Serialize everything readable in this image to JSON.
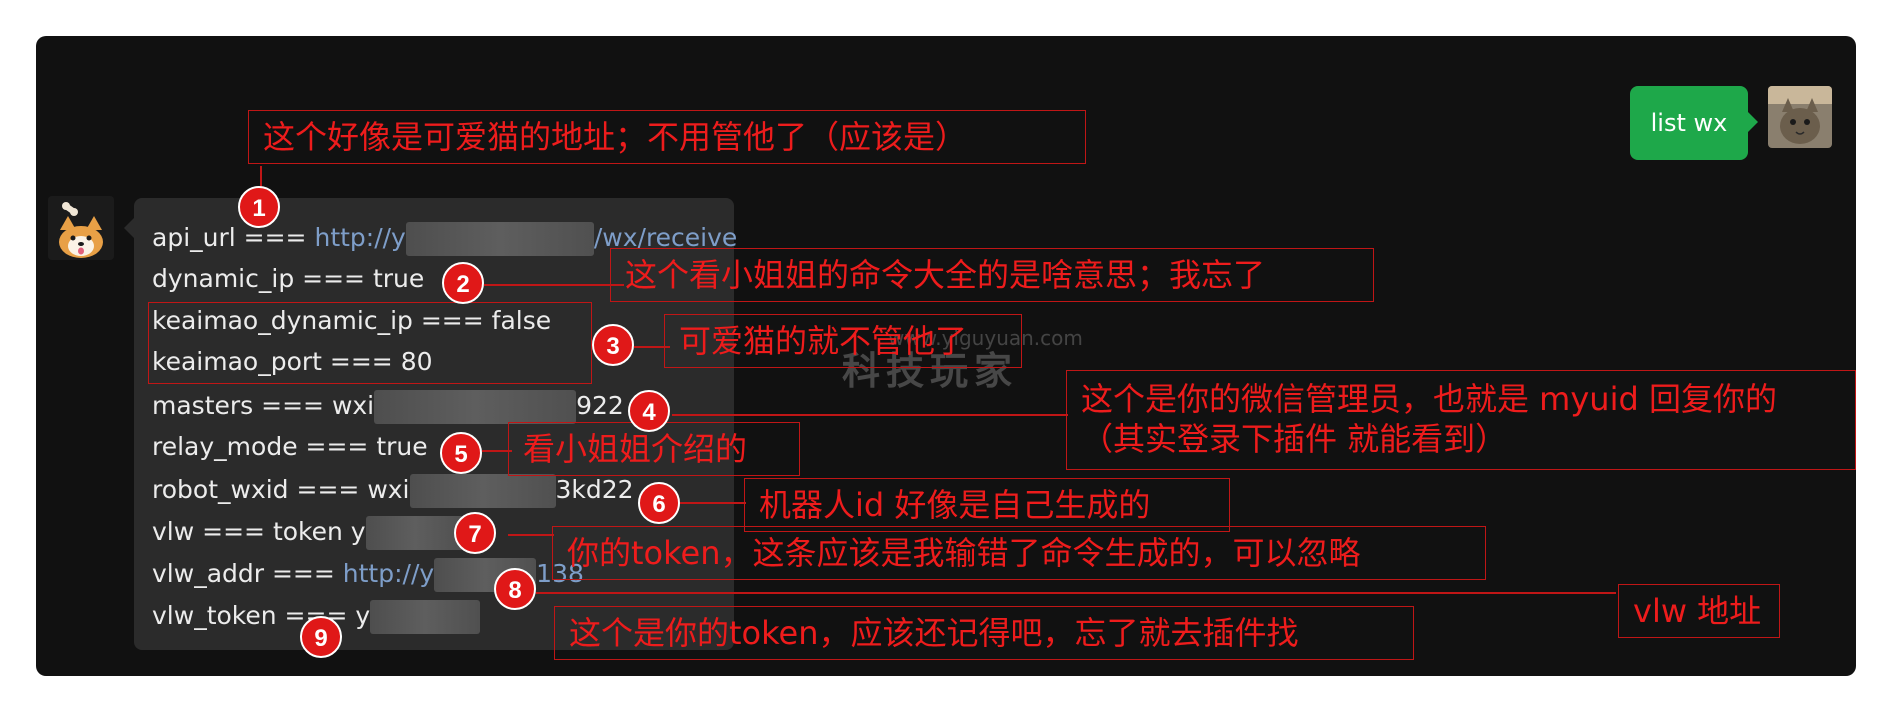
{
  "sent_message": {
    "text": "list wx"
  },
  "reply": {
    "lines": [
      {
        "key": "api_url",
        "sep": " === ",
        "value_start": "http://y",
        "value_end": "/wx/receive"
      },
      {
        "key": "dynamic_ip",
        "sep": " === ",
        "value": "true"
      },
      {
        "key": "keaimao_dynamic_ip",
        "sep": " === ",
        "value": "false"
      },
      {
        "key": "keaimao_port",
        "sep": " === ",
        "value": "80"
      },
      {
        "key": "masters",
        "sep": " === ",
        "value_start": "wxi",
        "value_end": "922"
      },
      {
        "key": "relay_mode",
        "sep": " === ",
        "value": "true"
      },
      {
        "key": "robot_wxid",
        "sep": " === ",
        "value_start": "wxi",
        "value_end": "3kd22"
      },
      {
        "key": "vlw",
        "sep": " === ",
        "value_start": "token y"
      },
      {
        "key": "vlw_addr",
        "sep": " === ",
        "value_start": "http://y",
        "value_end": "138"
      },
      {
        "key": "vlw_token",
        "sep": " === ",
        "value_start": "y"
      }
    ]
  },
  "annotations": {
    "n1": "这个好像是可爱猫的地址；不用管他了（应该是）",
    "n2": "这个看小姐姐的命令大全的是啥意思；我忘了",
    "n3": "可爱猫的就不管他了",
    "n4_line1": "这个是你的微信管理员，也就是 myuid 回复你的",
    "n4_line2": "（其实登录下插件 就能看到）",
    "n5": "看小姐姐介绍的",
    "n6": "机器人id  好像是自己生成的",
    "n7": "你的token，这条应该是我输错了命令生成的，可以忽略",
    "n8": "vlw 地址",
    "n9": "这个是你的token，应该还记得吧，忘了就去插件找"
  },
  "badges": [
    "1",
    "2",
    "3",
    "4",
    "5",
    "6",
    "7",
    "8",
    "9"
  ],
  "watermark": {
    "text": "科技玩家",
    "url": "www.yiguyuan.com"
  },
  "colors": {
    "background": "#111111",
    "bubble": "#2b2b2b",
    "sent_bubble": "#1ea84a",
    "annotation": "#ee1c1c",
    "badge": "#e01818",
    "link": "#7e9ec9"
  }
}
